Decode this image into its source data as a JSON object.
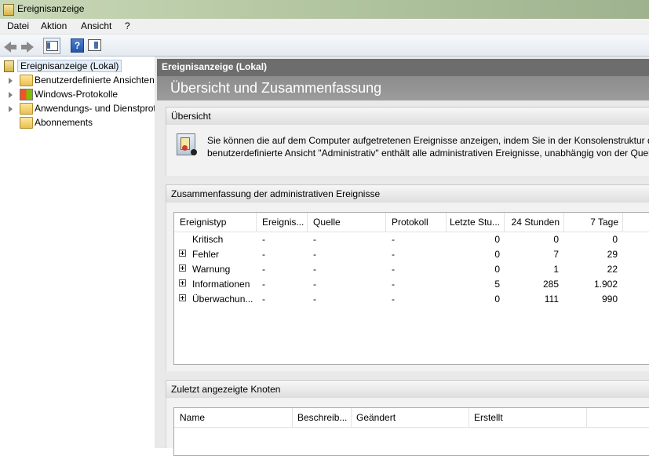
{
  "window": {
    "title": "Ereignisanzeige"
  },
  "menu": [
    "Datei",
    "Aktion",
    "Ansicht",
    "?"
  ],
  "toolbar": {
    "back_icon": "back-arrow-icon",
    "forward_icon": "forward-arrow-icon",
    "console_tree_icon": "console-tree-icon",
    "help_icon": "help-icon",
    "action_pane_icon": "action-pane-icon"
  },
  "tree": [
    {
      "label": "Ereignisanzeige (Lokal)",
      "expandable": false,
      "selected": true
    },
    {
      "label": "Benutzerdefinierte Ansichten",
      "expandable": true
    },
    {
      "label": "Windows-Protokolle",
      "expandable": true
    },
    {
      "label": "Anwendungs- und Dienstprotokolle",
      "expandable": true
    },
    {
      "label": "Abonnements",
      "expandable": false
    }
  ],
  "right": {
    "header": "Ereignisanzeige (Lokal)",
    "subtitle": "Übersicht und Zusammenfassung",
    "overview": {
      "title": "Übersicht",
      "line1": "Sie können die auf dem Computer aufgetretenen Ereignisse anzeigen, indem Sie in der Konsolenstruktur den",
      "line2": "benutzerdefinierte Ansicht \"Administrativ\" enthält alle administrativen Ereignisse, unabhängig von der Quelle"
    },
    "summary": {
      "title": "Zusammenfassung der administrativen Ereignisse",
      "columns": [
        "Ereignistyp",
        "Ereignis...",
        "Quelle",
        "Protokoll",
        "Letzte Stu...",
        "24 Stunden",
        "7 Tage"
      ],
      "rows": [
        {
          "type": "Kritisch",
          "id": "-",
          "source": "-",
          "log": "-",
          "hour": "0",
          "day": "0",
          "week": "0",
          "expandable": false
        },
        {
          "type": "Fehler",
          "id": "-",
          "source": "-",
          "log": "-",
          "hour": "0",
          "day": "7",
          "week": "29",
          "expandable": true
        },
        {
          "type": "Warnung",
          "id": "-",
          "source": "-",
          "log": "-",
          "hour": "0",
          "day": "1",
          "week": "22",
          "expandable": true
        },
        {
          "type": "Informationen",
          "id": "-",
          "source": "-",
          "log": "-",
          "hour": "5",
          "day": "285",
          "week": "1.902",
          "expandable": true
        },
        {
          "type": "Überwachun...",
          "id": "-",
          "source": "-",
          "log": "-",
          "hour": "0",
          "day": "111",
          "week": "990",
          "expandable": true
        }
      ]
    },
    "recent": {
      "title": "Zuletzt angezeigte Knoten",
      "columns": [
        "Name",
        "Beschreib...",
        "Geändert",
        "Erstellt"
      ]
    }
  }
}
